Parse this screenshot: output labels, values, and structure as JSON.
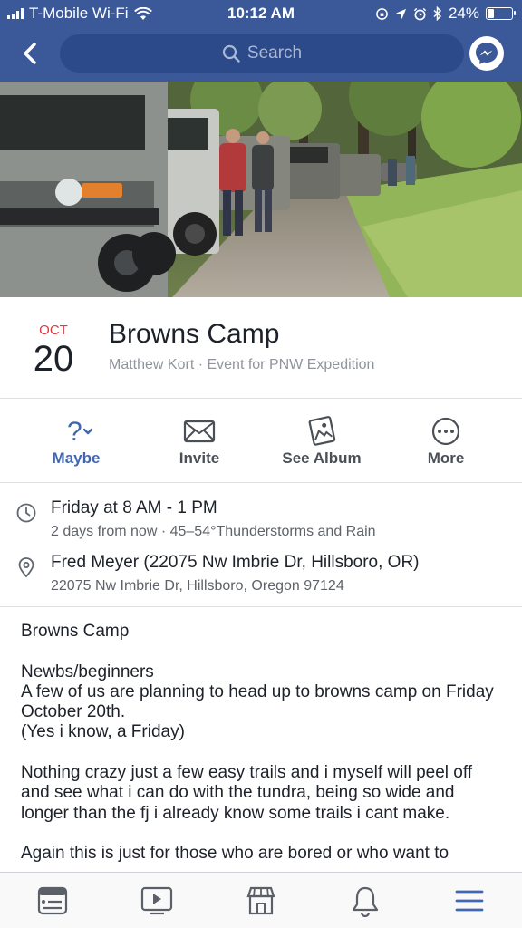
{
  "status_bar": {
    "carrier": "T-Mobile Wi-Fi",
    "time": "10:12 AM",
    "battery": "24%",
    "battery_level": 0.24
  },
  "search": {
    "placeholder": "Search"
  },
  "event": {
    "month": "OCT",
    "day": "20",
    "title": "Browns Camp",
    "subtitle": "Matthew Kort · Event for PNW Expedition"
  },
  "actions": [
    {
      "label": "Maybe",
      "icon": "question-mark-icon"
    },
    {
      "label": "Invite",
      "icon": "envelope-icon"
    },
    {
      "label": "See Album",
      "icon": "photo-album-icon"
    },
    {
      "label": "More",
      "icon": "more-dots-icon"
    }
  ],
  "details": {
    "time": {
      "line1": "Friday at 8 AM - 1 PM",
      "line2": "2 days from now · 45–54°Thunderstorms and Rain"
    },
    "location": {
      "line1": "Fred Meyer (22075 Nw Imbrie Dr, Hillsboro, OR)",
      "line2": "22075 Nw Imbrie Dr, Hillsboro, Oregon 97124"
    }
  },
  "description": "Browns Camp\n\nNewbs/beginners\nA few of us are planning to head up to browns camp on Friday October 20th.\n(Yes i know, a Friday)\n\nNothing crazy just a few easy trails and i myself will peel off and see what i can do with the tundra, being so wide and longer than the fj i already know some trails i cant make.\n\nAgain this is just for those who are bored or who want to",
  "colors": {
    "brand": "#3b5998",
    "accent": "#4267b2",
    "date_red": "#e0393e"
  },
  "tab_bar": [
    "news-feed-icon",
    "video-icon",
    "marketplace-icon",
    "notifications-bell-icon",
    "menu-icon"
  ]
}
